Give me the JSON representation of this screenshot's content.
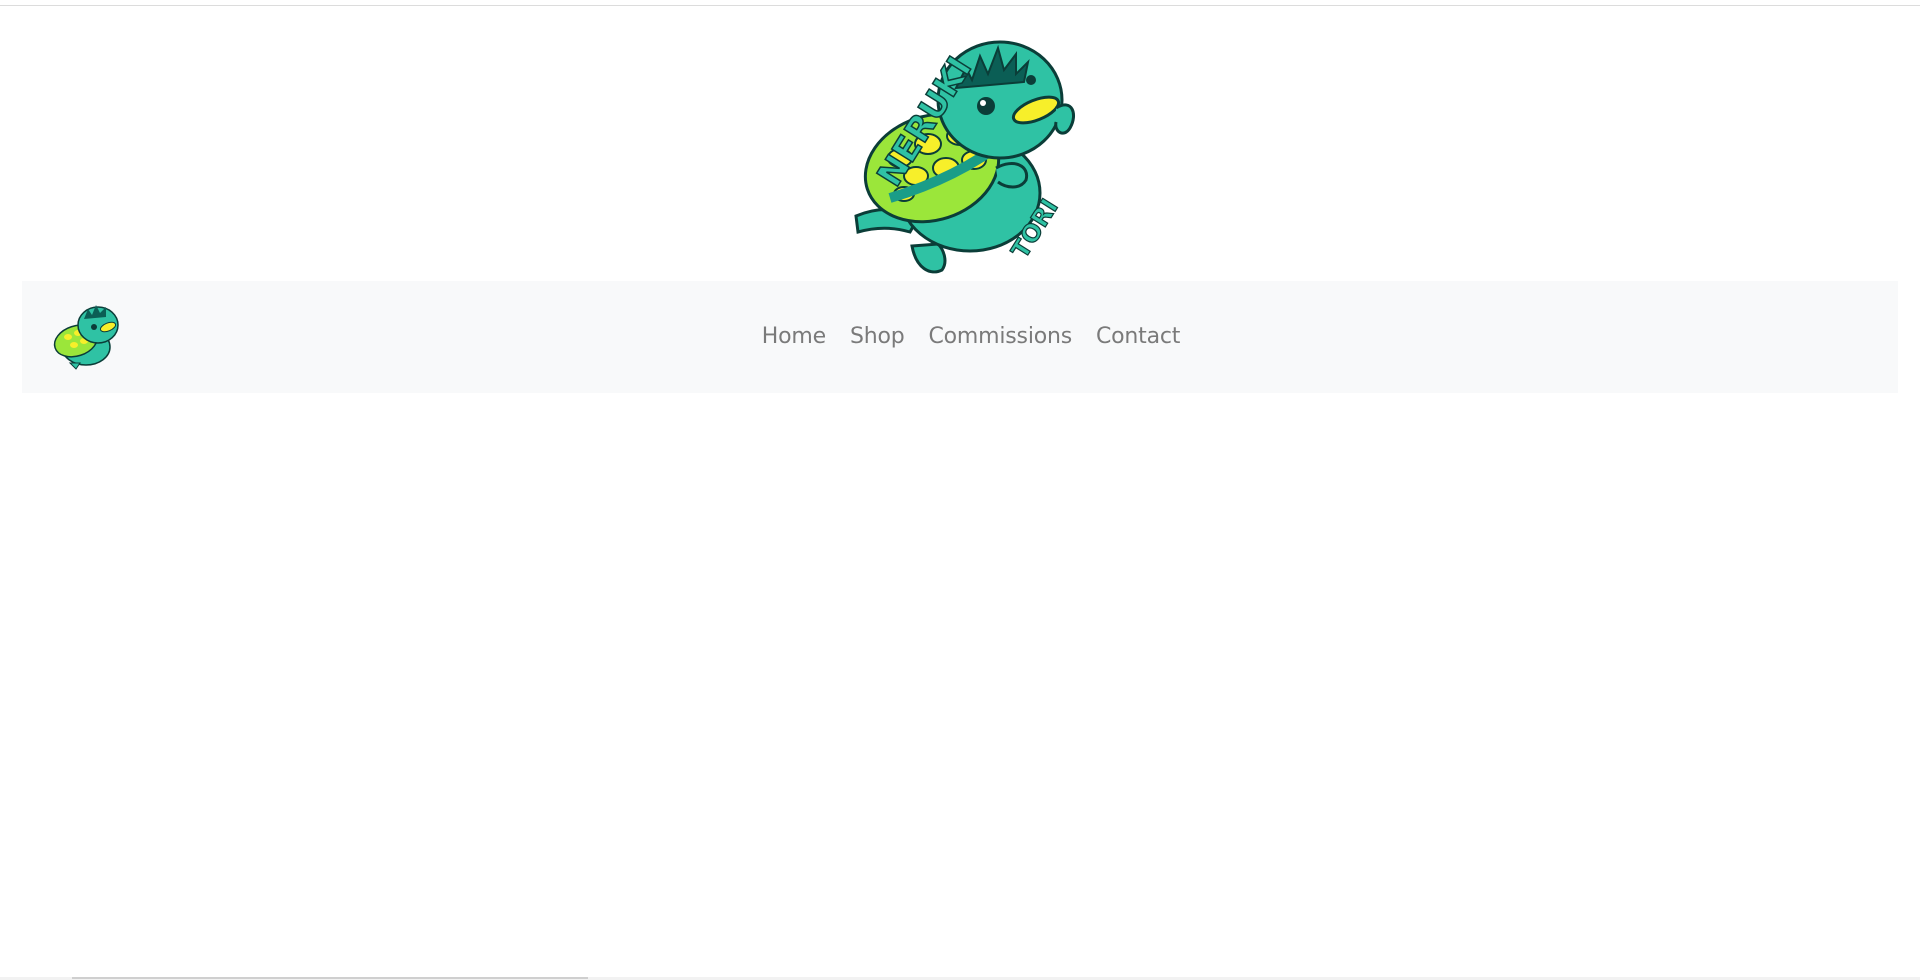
{
  "header": {
    "logo_icon": "turtle-mascot-icon",
    "logo_text_top": "NERUKI",
    "logo_text_bottom": "TORI"
  },
  "navbar": {
    "brand_icon": "turtle-mascot-icon",
    "links": [
      {
        "label": "Home"
      },
      {
        "label": "Shop"
      },
      {
        "label": "Commissions"
      },
      {
        "label": "Contact"
      }
    ]
  },
  "colors": {
    "navbar_bg": "#f8f9fa",
    "link": "#7a7a7a",
    "mascot_teal": "#2fc2a4",
    "mascot_dark": "#0b5e55",
    "shell_green": "#9be63a",
    "beak_yellow": "#f7ef2a"
  }
}
